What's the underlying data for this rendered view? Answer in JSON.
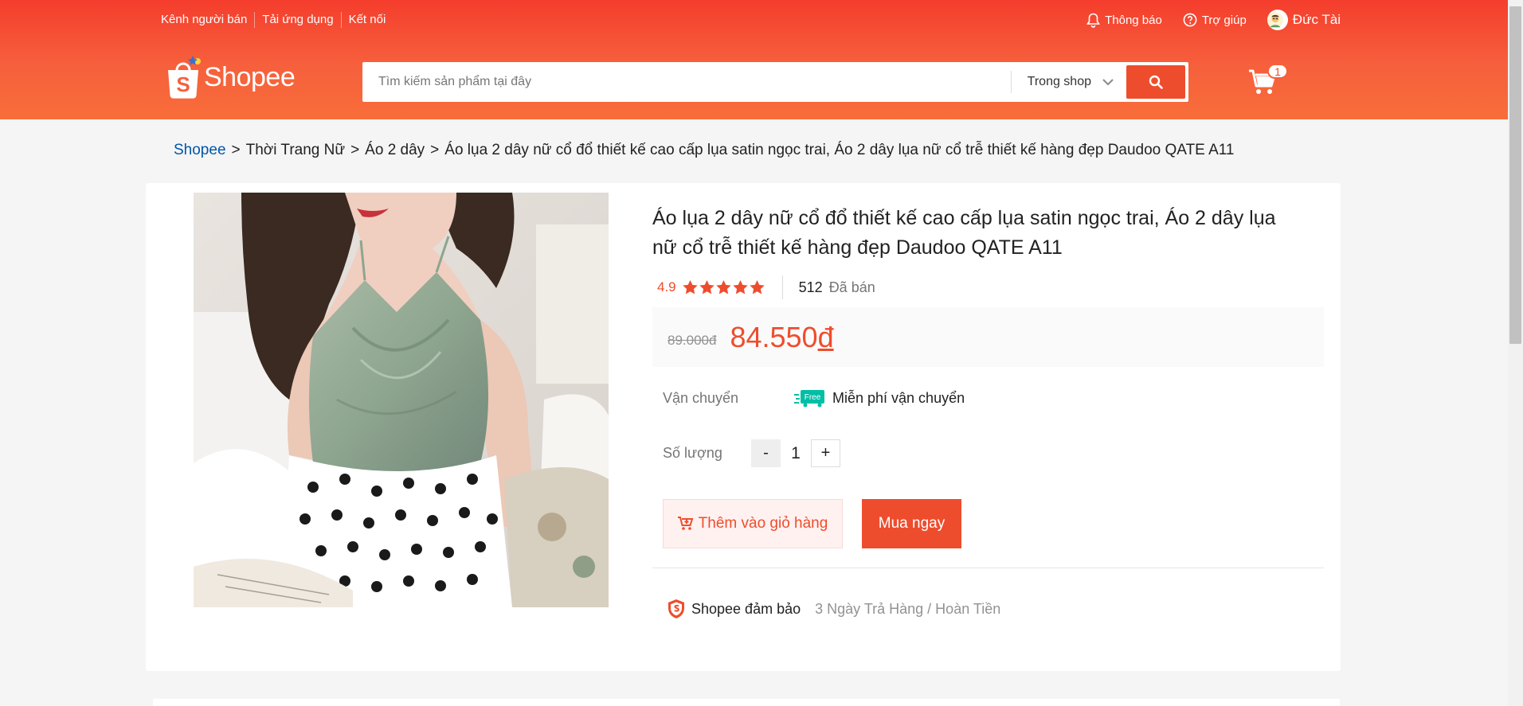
{
  "topbar": {
    "links": [
      "Kênh người bán",
      "Tải ứng dụng",
      "Kết nối"
    ],
    "notifications": "Thông báo",
    "help": "Trợ giúp",
    "username": "Đức Tài"
  },
  "header": {
    "logo_text": "Shopee",
    "search_placeholder": "Tìm kiếm sản phẩm tại đây",
    "search_scope": "Trong shop",
    "cart_count": "1"
  },
  "breadcrumb": {
    "items": [
      "Shopee",
      "Thời Trang Nữ",
      "Áo 2 dây",
      "Áo lụa 2 dây nữ cổ đổ thiết kế cao cấp lụa satin ngọc trai, Áo 2 dây lụa nữ cổ trễ thiết kế hàng đẹp Daudoo QATE A11"
    ],
    "separator": ">"
  },
  "product": {
    "title": "Áo lụa 2 dây nữ cổ đổ thiết kế cao cấp lụa satin ngọc trai, Áo 2 dây lụa nữ cổ trễ thiết kế hàng đẹp Daudoo QATE A11",
    "rating": "4.9",
    "stars": 5,
    "sold_count": "512",
    "sold_label": "Đã bán",
    "old_price": "89.000đ",
    "price_number": "84.550",
    "price_currency": "đ",
    "shipping_label": "Vận chuyển",
    "free_badge": "Free",
    "shipping_text": "Miễn phí vận chuyển",
    "quantity_label": "Số lượng",
    "quantity_minus": "-",
    "quantity_value": "1",
    "quantity_plus": "+",
    "add_to_cart": "Thêm vào giỏ hàng",
    "buy_now": "Mua ngay",
    "guarantee_title": "Shopee đảm bảo",
    "guarantee_text": "3 Ngày Trả Hàng / Hoàn Tiền"
  },
  "colors": {
    "brand": "#ee4d2d",
    "header_top": "#f53d2d",
    "header_bottom": "#f86d3a",
    "link": "#0055aa",
    "free_badge": "#00bfa5"
  }
}
